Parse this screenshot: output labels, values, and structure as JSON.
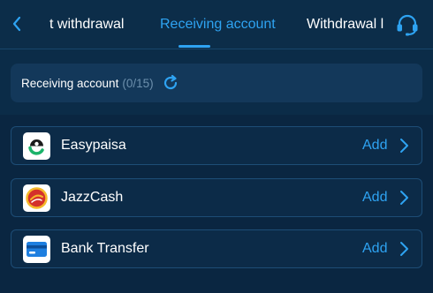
{
  "header": {
    "tabs": [
      {
        "label": "t withdrawal"
      },
      {
        "label": "Receiving account"
      },
      {
        "label": "Withdrawal l"
      }
    ],
    "active_tab": 1,
    "back_icon": "chevron-left-icon",
    "support_icon": "headset-icon"
  },
  "account_bar": {
    "label": "Receiving account",
    "count": "(0/15)",
    "refresh_icon": "refresh-icon"
  },
  "methods": [
    {
      "name": "Easypaisa",
      "action": "Add",
      "logo": "easypaisa-logo"
    },
    {
      "name": "JazzCash",
      "action": "Add",
      "logo": "jazzcash-logo"
    },
    {
      "name": "Bank Transfer",
      "action": "Add",
      "logo": "bank-card-icon"
    }
  ],
  "colors": {
    "accent": "#2ea3f2",
    "background": "#0b2c48",
    "panel": "#13385a",
    "muted": "#6d90ad"
  }
}
